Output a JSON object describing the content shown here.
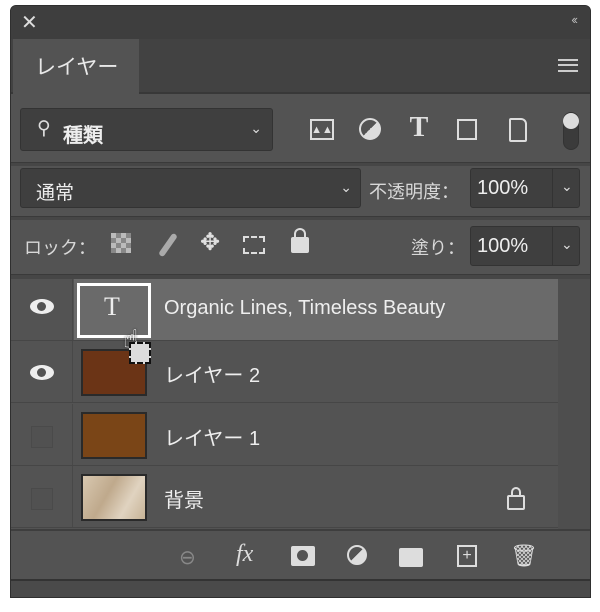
{
  "window": {
    "close_icon": "close-icon",
    "collapse_icon": "double-chevron-left-icon"
  },
  "tab": {
    "label": "レイヤー"
  },
  "filter": {
    "kind_label": "種類",
    "icons": [
      "image-filter-icon",
      "adjustment-filter-icon",
      "type-filter-icon",
      "shape-filter-icon",
      "smart-object-filter-icon"
    ]
  },
  "blend": {
    "mode": "通常",
    "opacity_label": "不透明度：",
    "opacity_value": "100%"
  },
  "lock": {
    "label": "ロック：",
    "fill_label": "塗り：",
    "fill_value": "100%"
  },
  "layers": [
    {
      "name": "Organic Lines, Timeless Beauty",
      "type": "text",
      "visible": true,
      "selected": true,
      "thumb_glyph": "T"
    },
    {
      "name": "レイヤー 2",
      "type": "pixel",
      "visible": true,
      "selected": false,
      "color": "#6b3416"
    },
    {
      "name": "レイヤー 1",
      "type": "pixel",
      "visible": false,
      "selected": false,
      "color": "#7a4517"
    },
    {
      "name": "背景",
      "type": "background",
      "visible": false,
      "selected": false,
      "color": "#cdbba3",
      "locked": true
    }
  ],
  "toolbar": {
    "fx_label": "fx"
  }
}
